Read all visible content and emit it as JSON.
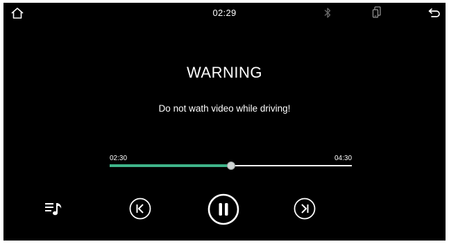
{
  "status_bar": {
    "time": "02:29",
    "icons": {
      "home": "home-icon",
      "bluetooth": "bluetooth-icon",
      "phone": "phone-mirror-icon",
      "back": "back-icon"
    }
  },
  "warning": {
    "title": "WARNING",
    "message": "Do not wath video while driving!"
  },
  "progress": {
    "elapsed": "02:30",
    "total": "04:30",
    "fraction": 0.5
  },
  "controls": {
    "playlist": "playlist-icon",
    "previous": "skip-previous-icon",
    "play_pause": "pause-icon",
    "next": "skip-next-icon"
  },
  "colors": {
    "background": "#000000",
    "foreground": "#ffffff",
    "progress_fill": "#3fb58a",
    "status_icon_dim": "#6b6b6b"
  }
}
